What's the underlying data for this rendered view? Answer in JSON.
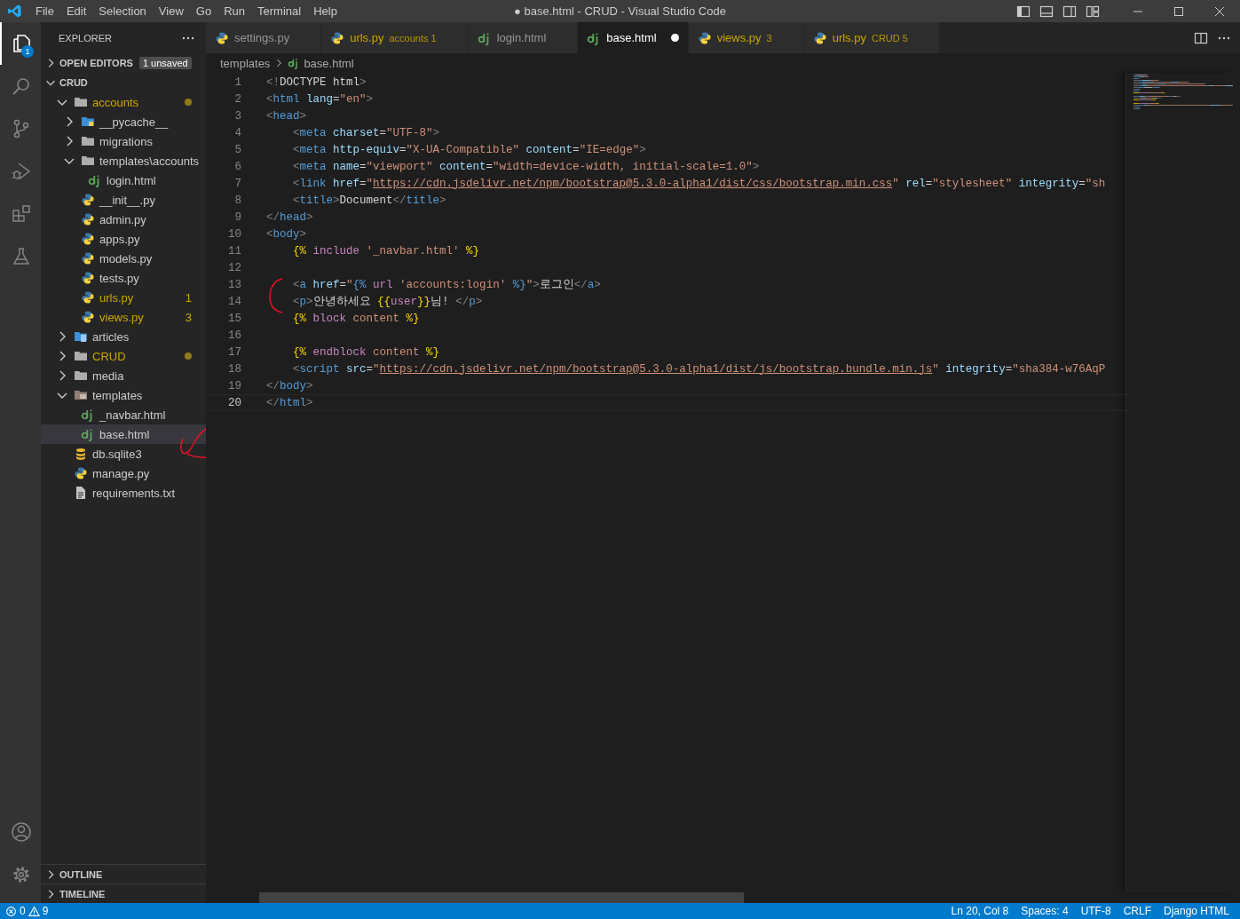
{
  "window": {
    "title": "● base.html - CRUD - Visual Studio Code"
  },
  "menu": [
    "File",
    "Edit",
    "Selection",
    "View",
    "Go",
    "Run",
    "Terminal",
    "Help"
  ],
  "activity_bar": {
    "top": [
      {
        "selected": true,
        "badge": "1"
      },
      {
        "selected": false
      },
      {
        "selected": false
      },
      {
        "selected": false
      },
      {
        "selected": false
      },
      {
        "selected": false
      }
    ]
  },
  "sidebar": {
    "title": "EXPLORER",
    "open_editors": {
      "label": "OPEN EDITORS",
      "badge": "1 unsaved",
      "expanded": false
    },
    "tree": {
      "label": "CRUD",
      "expanded": true,
      "children": [
        {
          "name": "accounts",
          "kind": "folder",
          "expanded": true,
          "selected": false,
          "warning": true,
          "dot": true,
          "children": [
            {
              "name": "__pycache__",
              "kind": "python-folder",
              "expanded": false,
              "selected": false,
              "warning": false,
              "dot": false
            },
            {
              "name": "migrations",
              "kind": "folder",
              "expanded": false,
              "selected": false,
              "warning": false,
              "dot": false
            },
            {
              "name": "templates\\accounts",
              "kind": "folder",
              "expanded": true,
              "selected": false,
              "warning": false,
              "dot": false,
              "children": [
                {
                  "name": "login.html",
                  "kind": "django",
                  "selected": false,
                  "warning": false,
                  "dot": false
                }
              ]
            },
            {
              "name": "__init__.py",
              "kind": "python",
              "selected": false,
              "warning": false,
              "dot": false
            },
            {
              "name": "admin.py",
              "kind": "python",
              "selected": false,
              "warning": false,
              "dot": false
            },
            {
              "name": "apps.py",
              "kind": "python",
              "selected": false,
              "warning": false,
              "dot": false
            },
            {
              "name": "models.py",
              "kind": "python",
              "selected": false,
              "warning": false,
              "dot": false
            },
            {
              "name": "tests.py",
              "kind": "python",
              "selected": false,
              "warning": false,
              "dot": false
            },
            {
              "name": "urls.py",
              "kind": "python",
              "selected": false,
              "warning": true,
              "dot": false,
              "badge": "1"
            },
            {
              "name": "views.py",
              "kind": "python",
              "selected": false,
              "warning": true,
              "dot": false,
              "badge": "3"
            }
          ]
        },
        {
          "name": "articles",
          "kind": "doc-folder",
          "expanded": false,
          "selected": false,
          "warning": false,
          "dot": false
        },
        {
          "name": "CRUD",
          "kind": "folder",
          "expanded": false,
          "selected": false,
          "warning": true,
          "dot": true
        },
        {
          "name": "media",
          "kind": "folder",
          "expanded": false,
          "selected": false,
          "warning": false,
          "dot": false
        },
        {
          "name": "templates",
          "kind": "templates-folder",
          "expanded": true,
          "selected": false,
          "warning": false,
          "dot": false,
          "children": [
            {
              "name": "_navbar.html",
              "kind": "django",
              "selected": false,
              "warning": false,
              "dot": false
            },
            {
              "name": "base.html",
              "kind": "django",
              "selected": true,
              "warning": false,
              "dot": false
            }
          ]
        },
        {
          "name": "db.sqlite3",
          "kind": "database",
          "selected": false,
          "warning": false,
          "dot": false
        },
        {
          "name": "manage.py",
          "kind": "python",
          "selected": false,
          "warning": false,
          "dot": false
        },
        {
          "name": "requirements.txt",
          "kind": "text",
          "selected": false,
          "warning": false,
          "dot": false
        }
      ]
    },
    "panels": [
      {
        "label": "OUTLINE",
        "expanded": false
      },
      {
        "label": "TIMELINE",
        "expanded": false
      }
    ]
  },
  "tabs": [
    {
      "label": "settings.py",
      "kind": "python",
      "selected": false,
      "warning": false,
      "dirty": false
    },
    {
      "label": "urls.py",
      "detail": "accounts",
      "badge": "1",
      "kind": "python",
      "selected": false,
      "warning": true,
      "dirty": false
    },
    {
      "label": "login.html",
      "kind": "django",
      "selected": false,
      "warning": false,
      "dirty": false
    },
    {
      "label": "base.html",
      "kind": "django",
      "selected": true,
      "warning": false,
      "dirty": true
    },
    {
      "label": "views.py",
      "badge": "3",
      "kind": "python",
      "selected": false,
      "warning": true,
      "dirty": false
    },
    {
      "label": "urls.py",
      "detail": "CRUD",
      "badge": "5",
      "kind": "python",
      "selected": false,
      "warning": true,
      "dirty": false
    }
  ],
  "breadcrumbs": [
    "templates",
    "base.html"
  ],
  "code": [
    {
      "number": "1",
      "current": false,
      "tokens": [
        {
          "kind": "punct",
          "text": "<!"
        },
        {
          "kind": "text",
          "text": "DOCTYPE html"
        },
        {
          "kind": "punct",
          "text": ">"
        }
      ]
    },
    {
      "number": "2",
      "current": false,
      "tokens": [
        {
          "kind": "punct",
          "text": "<"
        },
        {
          "kind": "tag",
          "text": "html"
        },
        {
          "kind": "attr",
          "text": " lang"
        },
        {
          "kind": "text",
          "text": "="
        },
        {
          "kind": "string",
          "text": "\"en\""
        },
        {
          "kind": "punct",
          "text": ">"
        }
      ]
    },
    {
      "number": "3",
      "current": false,
      "tokens": [
        {
          "kind": "punct",
          "text": "<"
        },
        {
          "kind": "tag",
          "text": "head"
        },
        {
          "kind": "punct",
          "text": ">"
        }
      ]
    },
    {
      "number": "4",
      "current": false,
      "tokens": [
        {
          "kind": "punct",
          "text": "    <"
        },
        {
          "kind": "tag",
          "text": "meta"
        },
        {
          "kind": "attr",
          "text": " charset"
        },
        {
          "kind": "text",
          "text": "="
        },
        {
          "kind": "string",
          "text": "\"UTF-8\""
        },
        {
          "kind": "punct",
          "text": ">"
        }
      ]
    },
    {
      "number": "5",
      "current": false,
      "tokens": [
        {
          "kind": "punct",
          "text": "    <"
        },
        {
          "kind": "tag",
          "text": "meta"
        },
        {
          "kind": "attr",
          "text": " http-equiv"
        },
        {
          "kind": "text",
          "text": "="
        },
        {
          "kind": "string",
          "text": "\"X-UA-Compatible\""
        },
        {
          "kind": "attr",
          "text": " content"
        },
        {
          "kind": "text",
          "text": "="
        },
        {
          "kind": "string",
          "text": "\"IE=edge\""
        },
        {
          "kind": "punct",
          "text": ">"
        }
      ]
    },
    {
      "number": "6",
      "current": false,
      "tokens": [
        {
          "kind": "punct",
          "text": "    <"
        },
        {
          "kind": "tag",
          "text": "meta"
        },
        {
          "kind": "attr",
          "text": " name"
        },
        {
          "kind": "text",
          "text": "="
        },
        {
          "kind": "string",
          "text": "\"viewport\""
        },
        {
          "kind": "attr",
          "text": " content"
        },
        {
          "kind": "text",
          "text": "="
        },
        {
          "kind": "string",
          "text": "\"width=device-width, initial-scale=1.0\""
        },
        {
          "kind": "punct",
          "text": ">"
        }
      ]
    },
    {
      "number": "7",
      "current": false,
      "tokens": [
        {
          "kind": "punct",
          "text": "    <"
        },
        {
          "kind": "tag",
          "text": "link"
        },
        {
          "kind": "attr",
          "text": " href"
        },
        {
          "kind": "text",
          "text": "="
        },
        {
          "kind": "string",
          "text": "\""
        },
        {
          "kind": "url",
          "text": "https://cdn.jsdelivr.net/npm/bootstrap@5.3.0-alpha1/dist/css/bootstrap.min.css"
        },
        {
          "kind": "string",
          "text": "\""
        },
        {
          "kind": "attr",
          "text": " rel"
        },
        {
          "kind": "text",
          "text": "="
        },
        {
          "kind": "string",
          "text": "\"stylesheet\""
        },
        {
          "kind": "attr",
          "text": " integrity"
        },
        {
          "kind": "text",
          "text": "="
        },
        {
          "kind": "string",
          "text": "\"sh"
        }
      ]
    },
    {
      "number": "8",
      "current": false,
      "tokens": [
        {
          "kind": "punct",
          "text": "    <"
        },
        {
          "kind": "tag",
          "text": "title"
        },
        {
          "kind": "punct",
          "text": ">"
        },
        {
          "kind": "text",
          "text": "Document"
        },
        {
          "kind": "punct",
          "text": "</"
        },
        {
          "kind": "tag",
          "text": "title"
        },
        {
          "kind": "punct",
          "text": ">"
        }
      ]
    },
    {
      "number": "9",
      "current": false,
      "tokens": [
        {
          "kind": "punct",
          "text": "</"
        },
        {
          "kind": "tag",
          "text": "head"
        },
        {
          "kind": "punct",
          "text": ">"
        }
      ]
    },
    {
      "number": "10",
      "current": false,
      "tokens": [
        {
          "kind": "punct",
          "text": "<"
        },
        {
          "kind": "tag",
          "text": "body"
        },
        {
          "kind": "punct",
          "text": ">"
        }
      ]
    },
    {
      "number": "11",
      "current": false,
      "tokens": [
        {
          "kind": "template",
          "text": "    {%"
        },
        {
          "kind": "keyword",
          "text": " include "
        },
        {
          "kind": "string",
          "text": "'_navbar.html'"
        },
        {
          "kind": "template",
          "text": " %}"
        }
      ]
    },
    {
      "number": "12",
      "current": false
    },
    {
      "number": "13",
      "current": false,
      "tokens": [
        {
          "kind": "punct",
          "text": "    <"
        },
        {
          "kind": "tag",
          "text": "a"
        },
        {
          "kind": "attr",
          "text": " href"
        },
        {
          "kind": "text",
          "text": "="
        },
        {
          "kind": "string",
          "text": "\""
        },
        {
          "kind": "tag",
          "text": "{%"
        },
        {
          "kind": "keyword",
          "text": " url "
        },
        {
          "kind": "string",
          "text": "'accounts:login'"
        },
        {
          "kind": "tag",
          "text": " %}"
        },
        {
          "kind": "string",
          "text": "\""
        },
        {
          "kind": "punct",
          "text": ">"
        },
        {
          "kind": "text",
          "text": "로그인"
        },
        {
          "kind": "punct",
          "text": "</"
        },
        {
          "kind": "tag",
          "text": "a"
        },
        {
          "kind": "punct",
          "text": ">"
        }
      ]
    },
    {
      "number": "14",
      "current": false,
      "tokens": [
        {
          "kind": "punct",
          "text": "    <"
        },
        {
          "kind": "tag",
          "text": "p"
        },
        {
          "kind": "punct",
          "text": ">"
        },
        {
          "kind": "text",
          "text": "안녕하세요 "
        },
        {
          "kind": "template",
          "text": "{{"
        },
        {
          "kind": "keyword",
          "text": "user"
        },
        {
          "kind": "template",
          "text": "}}"
        },
        {
          "kind": "text",
          "text": "님! "
        },
        {
          "kind": "punct",
          "text": "</"
        },
        {
          "kind": "tag",
          "text": "p"
        },
        {
          "kind": "punct",
          "text": ">"
        }
      ]
    },
    {
      "number": "15",
      "current": false,
      "tokens": [
        {
          "kind": "template",
          "text": "    {%"
        },
        {
          "kind": "keyword",
          "text": " block "
        },
        {
          "kind": "string",
          "text": "content"
        },
        {
          "kind": "template",
          "text": " %}"
        }
      ]
    },
    {
      "number": "16",
      "current": false
    },
    {
      "number": "17",
      "current": false,
      "tokens": [
        {
          "kind": "template",
          "text": "    {%"
        },
        {
          "kind": "keyword",
          "text": " endblock "
        },
        {
          "kind": "string",
          "text": "content"
        },
        {
          "kind": "template",
          "text": " %}"
        }
      ]
    },
    {
      "number": "18",
      "current": false,
      "tokens": [
        {
          "kind": "punct",
          "text": "    <"
        },
        {
          "kind": "tag",
          "text": "script"
        },
        {
          "kind": "attr",
          "text": " src"
        },
        {
          "kind": "text",
          "text": "="
        },
        {
          "kind": "string",
          "text": "\""
        },
        {
          "kind": "url",
          "text": "https://cdn.jsdelivr.net/npm/bootstrap@5.3.0-alpha1/dist/js/bootstrap.bundle.min.js"
        },
        {
          "kind": "string",
          "text": "\""
        },
        {
          "kind": "attr",
          "text": " integrity"
        },
        {
          "kind": "text",
          "text": "="
        },
        {
          "kind": "string",
          "text": "\"sha384-w76AqP"
        }
      ]
    },
    {
      "number": "19",
      "current": false,
      "tokens": [
        {
          "kind": "punct",
          "text": "</"
        },
        {
          "kind": "tag",
          "text": "body"
        },
        {
          "kind": "punct",
          "text": ">"
        }
      ]
    },
    {
      "number": "20",
      "current": true,
      "tokens": [
        {
          "kind": "punct",
          "text": "</"
        },
        {
          "kind": "tag",
          "text": "html"
        },
        {
          "kind": "punct",
          "text": ">"
        }
      ]
    }
  ],
  "status_bar": {
    "errors": "0",
    "warnings": "9",
    "items": [
      "Ln 20, Col 8",
      "Spaces: 4",
      "UTF-8",
      "CRLF",
      "Django HTML"
    ]
  }
}
